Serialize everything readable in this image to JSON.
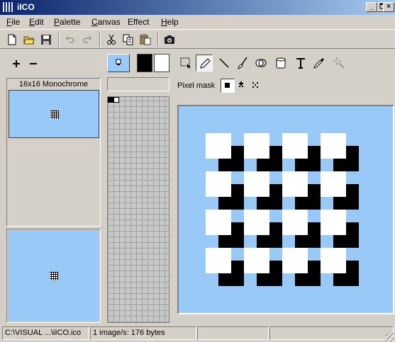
{
  "window": {
    "title": "iICO",
    "minimize": "_",
    "maximize": "□",
    "close": "×"
  },
  "menu": [
    {
      "label": "File",
      "key": "F",
      "rest": "ile"
    },
    {
      "label": "Edit",
      "key": "E",
      "rest": "dit"
    },
    {
      "label": "Palette",
      "key": "P",
      "rest": "alette"
    },
    {
      "label": "Canvas",
      "key": "C",
      "rest": "anvas"
    },
    {
      "label": "Effect",
      "key": "",
      "rest": "Effect"
    },
    {
      "label": "Help",
      "key": "H",
      "rest": "elp"
    }
  ],
  "toolbar": {
    "icons": [
      "new-file-icon",
      "open-folder-icon",
      "save-disk-icon",
      "undo-icon",
      "redo-icon",
      "cut-icon",
      "copy-icon",
      "paste-icon",
      "capture-camera-icon"
    ]
  },
  "left_panel": {
    "add_icon": "plus-icon",
    "remove_icon": "minus-icon",
    "format_label": "16x16 Monochrome"
  },
  "palette": {
    "foreground_color": "#000000",
    "background_color": "#ffffff",
    "screen_color": "#99c9f6"
  },
  "tools": {
    "icons": [
      "select-rect-icon",
      "pencil-icon",
      "line-icon",
      "brush-icon",
      "fill-icon",
      "eraser-icon",
      "text-icon",
      "eyedropper-icon",
      "magic-wand-icon"
    ],
    "active": "pencil-icon"
  },
  "mask": {
    "label": "Pixel mask",
    "options": [
      "mask-solid-icon",
      "mask-diamond-icon",
      "mask-x-icon"
    ],
    "active": "mask-solid-icon"
  },
  "canvas": {
    "background": "#99c9f6",
    "grid_rows": 4,
    "grid_cols": 4
  },
  "status": {
    "path": "C:\\VISUAL ...\\iICO.ico",
    "info": "1 image/s: 176 bytes",
    "field3": "",
    "field4": ""
  }
}
